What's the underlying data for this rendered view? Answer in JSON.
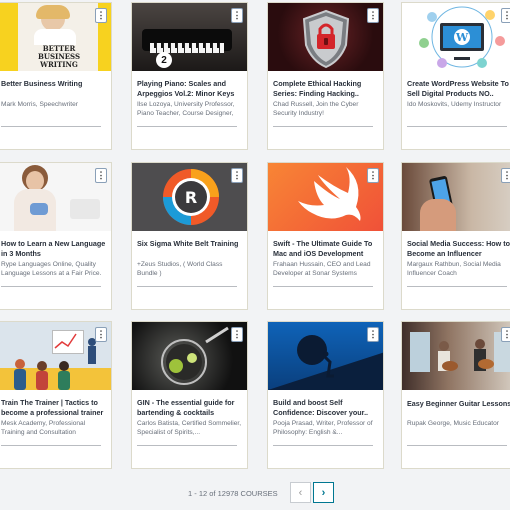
{
  "courses": [
    {
      "title": "Better Business Writing",
      "author": "Mark Morris, Speechwriter",
      "thumb_text": "BETTER BUSINESS WRITING"
    },
    {
      "title": "Playing Piano: Scales and Arpeggios Vol.2: Minor Keys",
      "author": "Ilse Lozoya, University Professor, Piano Teacher, Course Designer,",
      "thumb_text": "2"
    },
    {
      "title": "Complete Ethical Hacking Series: Finding Hacking..",
      "author": "Chad Russell, Join the Cyber Security Industry!"
    },
    {
      "title": "Create WordPress Website To Sell Digital Products NO..",
      "author": "Ido Moskovits, Udemy Instructor"
    },
    {
      "title": "How to Learn a New Language in 3 Months",
      "author": "Rype Languages Online, Quality Language Lessons at a Fair Price."
    },
    {
      "title": "Six Sigma White Belt Training",
      "author": "+Zeus Studios, ( World Class Bundle )"
    },
    {
      "title": "Swift - The Ultimate Guide To Mac and iOS Development",
      "author": "Frahaan Hussain, CEO and Lead Developer at Sonar Systems"
    },
    {
      "title": "Social Media Success: How to Become an Influencer",
      "author": "Margaux Rathbun, Social Media Influencer Coach"
    },
    {
      "title": "Train The Trainer | Tactics to become a professional trainer",
      "author": "Mesk Academy, Professional Training and Consultation"
    },
    {
      "title": "GIN - The essential guide for bartending & cocktails",
      "author": "Carlos Batista, Certified Sommelier, Specialist of Spirits,..."
    },
    {
      "title": "Build and boost Self Confidence: Discover your..",
      "author": "Pooja Prasad, Writer, Professor of Philosophy: English &..."
    },
    {
      "title": "Easy Beginner Guitar Lessons",
      "author": "Rupak George, Music Educator"
    }
  ],
  "menu_label": "⋮",
  "pagination": {
    "summary": "1 - 12 of 12978 COURSES",
    "prev": "‹",
    "next": "›"
  },
  "colors": {
    "accent": "#007791",
    "card_border": "#dcdacb",
    "background": "#f2f3f5"
  }
}
